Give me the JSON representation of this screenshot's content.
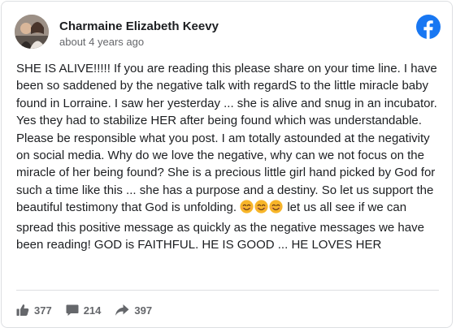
{
  "post": {
    "author": "Charmaine Elizabeth Keevy",
    "timestamp": "about 4 years ago",
    "avatar_icon": "profile-photo-avatar",
    "platform_icon": "facebook-logo-icon",
    "body_text": "SHE IS ALIVE!!!!! If you are reading this please share on your time line. I have been so saddened by the negative talk with regardS to the little miracle baby found in Lorraine. I saw her yesterday ... she is alive and snug in an incubator. Yes they had to stabilize HER after being found which was understandable. Please be responsible what you post. I am totally astounded at the negativity on social media. Why do we love the negative, why can we not focus on the miracle of her being found? She is a precious little girl hand picked by God for such a time like this ... she has a purpose and a destiny. So let us support the beautiful testimony that God is unfolding.",
    "emoji": "😊😊😊",
    "body_text_after": "let us all see if we can spread this positive message as quickly as the negative messages we have been reading! GOD is FAITHFUL. HE IS GOOD ... HE LOVES HER"
  },
  "stats": {
    "likes": "377",
    "comments": "214",
    "shares": "397"
  },
  "colors": {
    "facebook_blue": "#1877f2",
    "text": "#1c1e21",
    "secondary_text": "#65676b",
    "border": "#dddfe2",
    "emoji_face": "#f7b529"
  }
}
